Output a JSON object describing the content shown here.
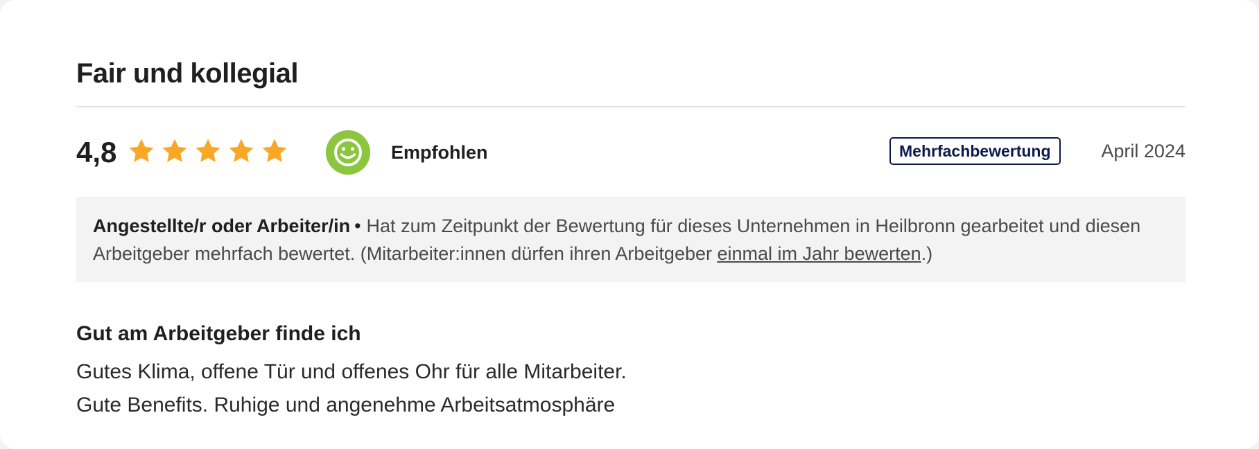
{
  "review": {
    "title": "Fair und kollegial",
    "score": "4,8",
    "stars": 5,
    "star_color": "#f9a826",
    "recommendation_label": "Empfohlen",
    "recommendation_icon": "smiley-icon",
    "recommendation_color": "#8cc63f",
    "badge_label": "Mehrfachbewertung",
    "badge_color": "#0c1a4b",
    "date": "April 2024"
  },
  "reviewer_info": {
    "role": "Angestellte/r oder Arbeiter/in",
    "bullet": "•",
    "text_before_link": "Hat zum Zeitpunkt der Bewertung für dieses Unternehmen in Heilbronn gearbeitet und diesen Arbeitgeber mehrfach bewertet. (Mitarbeiter:innen dürfen ihren Arbeitgeber ",
    "link_label": "einmal im Jahr bewerten",
    "text_after_link": ".)"
  },
  "section": {
    "heading": "Gut am Arbeitgeber finde ich",
    "lines": [
      "Gutes Klima, offene Tür und offenes Ohr für alle Mitarbeiter.",
      "Gute Benefits. Ruhige und angenehme Arbeitsatmosphäre"
    ]
  }
}
